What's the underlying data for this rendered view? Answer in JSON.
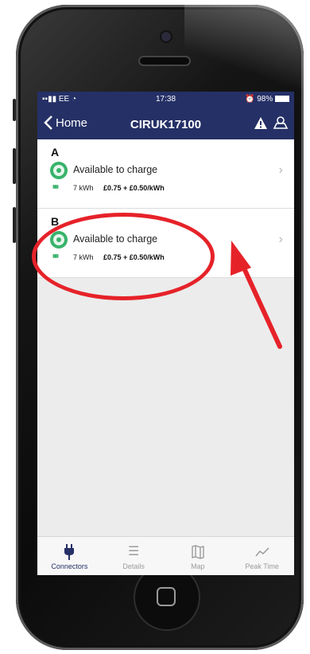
{
  "status_bar": {
    "carrier": "EE",
    "time": "17:38",
    "battery": "98%"
  },
  "nav": {
    "back_label": "Home",
    "title": "CIRUK17100"
  },
  "connectors": [
    {
      "letter": "A",
      "status": "Available to charge",
      "power": "7 kWh",
      "price": "£0.75 + £0.50/kWh"
    },
    {
      "letter": "B",
      "status": "Available to charge",
      "power": "7 kWh",
      "price": "£0.75 + £0.50/kWh"
    }
  ],
  "tabs": [
    {
      "label": "Connectors",
      "icon": "plug-icon",
      "active": true
    },
    {
      "label": "Details",
      "icon": "list-icon",
      "active": false
    },
    {
      "label": "Map",
      "icon": "map-icon",
      "active": false
    },
    {
      "label": "Peak Time",
      "icon": "trend-icon",
      "active": false
    }
  ],
  "colors": {
    "header": "#253066",
    "available": "#37b36b",
    "annotation": "#e62229"
  }
}
